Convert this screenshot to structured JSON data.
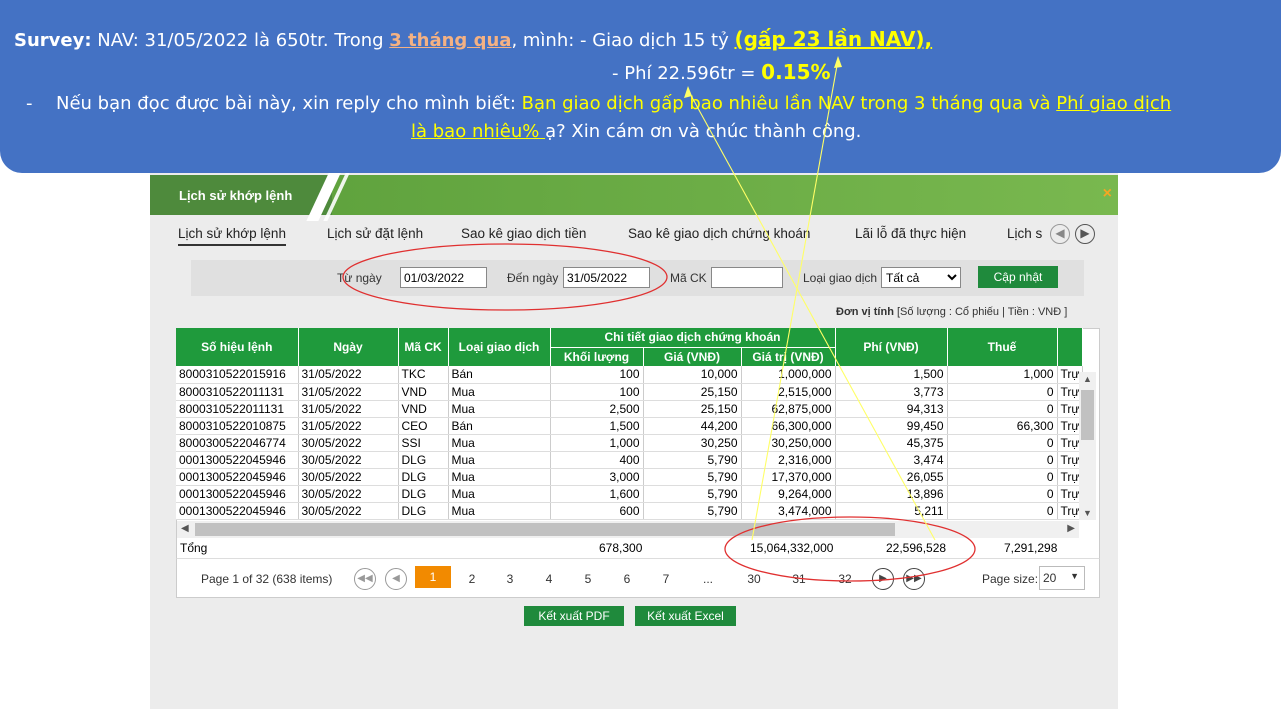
{
  "banner": {
    "lead": "Survey:",
    "l1_text": " NAV: 31/05/2022 là 650tr. Trong ",
    "l1_highlight": "3 tháng qua",
    "l1_mid": ", mình: - Giao dịch 15 tỷ ",
    "l1_yellow": "(gấp 23 lần NAV),",
    "l2_text": "- Phí 22.596tr = ",
    "l2_pct": "0.15%",
    "l3_dash": "-",
    "l3_text": "Nếu bạn đọc được bài này, xin reply cho mình biết: ",
    "l3_yellow": "Bạn giao dịch gấp bao nhiêu lần NAV trong 3 tháng qua và ",
    "l3_yellow_u1": "Phí giao dịch",
    "l3_yellow_u2": "là bao nhiêu% ",
    "l3_end": "ạ?  Xin cám ơn và chúc thành công."
  },
  "window": {
    "title": "Lịch sử khớp lệnh",
    "close": "×",
    "tabs": [
      "Lịch sử khớp lệnh",
      "Lịch sử đặt lệnh",
      "Sao kê giao dịch tiền",
      "Sao kê giao dịch chứng khoán",
      "Lãi lỗ đã thực hiện",
      "Lịch s"
    ]
  },
  "filter": {
    "from_label": "Từ ngày",
    "from_value": "01/03/2022",
    "to_label": "Đến ngày",
    "to_value": "31/05/2022",
    "code_label": "Mã CK",
    "code_value": "",
    "type_label": "Loại giao dịch",
    "type_value": "Tất cả",
    "update_button": "Cập nhật"
  },
  "unit": {
    "label": "Đơn vị tính",
    "text": "[Số lượng : Cổ phiếu  | Tiền : VNĐ ]"
  },
  "table": {
    "headers": {
      "order_no": "Số hiệu lệnh",
      "date": "Ngày",
      "code": "Mã CK",
      "type": "Loại giao dịch",
      "detail": "Chi tiết giao dịch chứng khoán",
      "qty": "Khối lượng",
      "price": "Giá (VNĐ)",
      "value": "Giá trị (VNĐ)",
      "fee": "Phí (VNĐ)",
      "tax": "Thuế"
    },
    "rows": [
      [
        "8000310522015916",
        "31/05/2022",
        "TKC",
        "Bán",
        "100",
        "10,000",
        "1,000,000",
        "1,500",
        "1,000",
        "Trự"
      ],
      [
        "8000310522011131",
        "31/05/2022",
        "VND",
        "Mua",
        "100",
        "25,150",
        "2,515,000",
        "3,773",
        "0",
        "Trự"
      ],
      [
        "8000310522011131",
        "31/05/2022",
        "VND",
        "Mua",
        "2,500",
        "25,150",
        "62,875,000",
        "94,313",
        "0",
        "Trự"
      ],
      [
        "8000310522010875",
        "31/05/2022",
        "CEO",
        "Bán",
        "1,500",
        "44,200",
        "66,300,000",
        "99,450",
        "66,300",
        "Trự"
      ],
      [
        "8000300522046774",
        "30/05/2022",
        "SSI",
        "Mua",
        "1,000",
        "30,250",
        "30,250,000",
        "45,375",
        "0",
        "Trự"
      ],
      [
        "0001300522045946",
        "30/05/2022",
        "DLG",
        "Mua",
        "400",
        "5,790",
        "2,316,000",
        "3,474",
        "0",
        "Trự"
      ],
      [
        "0001300522045946",
        "30/05/2022",
        "DLG",
        "Mua",
        "3,000",
        "5,790",
        "17,370,000",
        "26,055",
        "0",
        "Trự"
      ],
      [
        "0001300522045946",
        "30/05/2022",
        "DLG",
        "Mua",
        "1,600",
        "5,790",
        "9,264,000",
        "13,896",
        "0",
        "Trự"
      ],
      [
        "0001300522045946",
        "30/05/2022",
        "DLG",
        "Mua",
        "600",
        "5,790",
        "3,474,000",
        "5,211",
        "0",
        "Trự"
      ]
    ],
    "totals": {
      "label": "Tổng",
      "qty": "678,300",
      "value": "15,064,332,000",
      "fee": "22,596,528",
      "tax": "7,291,298"
    }
  },
  "pager": {
    "info": "Page 1 of 32 (638 items)",
    "pages": [
      "1",
      "2",
      "3",
      "4",
      "5",
      "6",
      "7",
      "...",
      "30",
      "31",
      "32"
    ],
    "current": "1",
    "page_size_label": "Page size:",
    "page_size": "20"
  },
  "export": {
    "pdf": "Kết xuất PDF",
    "excel": "Kết xuất Excel"
  },
  "colors": {
    "banner": "#4472c4",
    "header_green": "#1f9a3c",
    "accent_orange": "#f28a00",
    "annotation": "#ffff66",
    "circle": "#e03030"
  }
}
